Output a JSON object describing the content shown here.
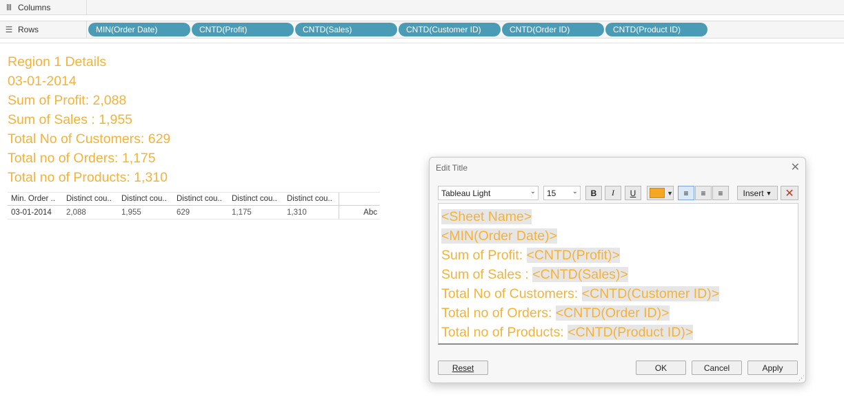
{
  "shelves": {
    "columns_label": "Columns",
    "rows_label": "Rows",
    "row_pills": [
      "MIN(Order Date)",
      "CNTD(Profit)",
      "CNTD(Sales)",
      "CNTD(Customer ID)",
      "CNTD(Order ID)",
      "CNTD(Product ID)"
    ]
  },
  "worksheet_title": {
    "lines": [
      "Region 1 Details",
      "03-01-2014",
      "Sum of Profit: 2,088",
      "Sum of Sales : 1,955",
      "Total No of Customers: 629",
      "Total no of Orders: 1,175",
      "Total no of Products: 1,310"
    ],
    "color": "#f5b23a"
  },
  "table": {
    "headers": [
      "Min. Order ..",
      "Distinct cou..",
      "Distinct cou..",
      "Distinct cou..",
      "Distinct cou..",
      "Distinct cou.."
    ],
    "row": [
      "03-01-2014",
      "2,088",
      "1,955",
      "629",
      "1,175",
      "1,310"
    ],
    "abc": "Abc"
  },
  "dialog": {
    "title": "Edit Title",
    "font_name": "Tableau Light",
    "font_size": "15",
    "bold": "B",
    "italic": "I",
    "underline": "U",
    "text_color": "#f5a623",
    "insert_label": "Insert",
    "editor_lines": [
      {
        "prefix": "",
        "token": "<Sheet Name>"
      },
      {
        "prefix": "",
        "token": "<MIN(Order Date)>"
      },
      {
        "prefix": "Sum of Profit: ",
        "token": "<CNTD(Profit)>"
      },
      {
        "prefix": "Sum of Sales : ",
        "token": "<CNTD(Sales)>"
      },
      {
        "prefix": "Total No of Customers: ",
        "token": "<CNTD(Customer ID)>"
      },
      {
        "prefix": "Total no of Orders: ",
        "token": "<CNTD(Order ID)>"
      },
      {
        "prefix": "Total no of Products: ",
        "token": "<CNTD(Product ID)>"
      }
    ],
    "reset_label": "Reset",
    "ok_label": "OK",
    "cancel_label": "Cancel",
    "apply_label": "Apply"
  }
}
